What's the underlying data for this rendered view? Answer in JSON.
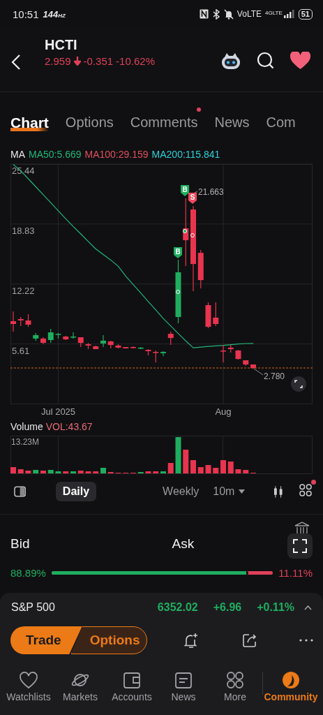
{
  "status_bar": {
    "time": "10:51",
    "refresh_rate": "144",
    "refresh_unit": "HZ",
    "network": "VoLTE",
    "network_type": "4GLTE",
    "battery": "51"
  },
  "header": {
    "symbol": "HCTI",
    "price": "2.959",
    "change": "-0.351",
    "change_percent": "-10.62%"
  },
  "tabs": [
    {
      "label": "Chart",
      "selected": true,
      "badge": false
    },
    {
      "label": "Options",
      "selected": false,
      "badge": false
    },
    {
      "label": "Comments",
      "selected": false,
      "badge": true
    },
    {
      "label": "News",
      "selected": false,
      "badge": false
    },
    {
      "label": "Com",
      "selected": false,
      "badge": false
    }
  ],
  "chart": {
    "indicator": "MA",
    "ma": [
      {
        "label": "MA100:29.159",
        "color": "#e0505f"
      },
      {
        "label": "MA200:115.841",
        "color": "#2fd0d8"
      }
    ],
    "chart_data": {
      "type": "candlestick",
      "grid": true,
      "ylim": [
        -1.04,
        25.44
      ],
      "yticks": [
        5.61,
        12.22,
        18.83,
        25.44
      ],
      "categories": [
        null,
        null,
        null,
        null,
        null,
        null,
        "Jul 2025",
        null,
        null,
        null,
        null,
        null,
        null,
        null,
        null,
        null,
        null,
        null,
        null,
        null,
        null,
        null,
        null,
        null,
        null,
        null,
        null,
        null,
        "Aug",
        null,
        null,
        null,
        null
      ],
      "ohlc": [
        [
          8.12,
          9.2,
          6.97,
          7.81
        ],
        [
          8.35,
          8.58,
          7.58,
          8.2
        ],
        [
          8.2,
          8.89,
          7.5,
          7.74
        ],
        [
          6.2,
          6.81,
          5.97,
          6.58
        ],
        [
          6.2,
          6.35,
          5.58,
          5.73
        ],
        [
          6.04,
          7.27,
          5.73,
          6.89
        ],
        [
          6.66,
          6.81,
          6.2,
          6.73
        ],
        [
          6.43,
          6.5,
          6.04,
          6.12
        ],
        [
          6.35,
          6.89,
          6.2,
          6.43
        ],
        [
          6.35,
          6.35,
          5.27,
          5.73
        ],
        [
          5.58,
          5.73,
          5.04,
          5.43
        ],
        [
          5.35,
          5.43,
          5.04,
          5.04
        ],
        [
          5.66,
          6.58,
          5.27,
          5.97
        ],
        [
          5.89,
          5.97,
          5.12,
          5.5
        ],
        [
          5.43,
          5.58,
          5.12,
          5.2
        ],
        [
          5.27,
          5.27,
          5.12,
          5.12
        ],
        [
          5.27,
          5.35,
          5.12,
          5.2
        ],
        [
          5.12,
          5.27,
          5.04,
          5.2
        ],
        [
          4.96,
          5.04,
          4.35,
          4.81
        ],
        [
          4.73,
          4.89,
          3.58,
          4.66
        ],
        [
          4.58,
          4.81,
          4.27,
          4.73
        ],
        [
          6.73,
          6.97,
          5.5,
          6.27
        ],
        [
          8.58,
          14.89,
          7.89,
          13.51
        ],
        [
          18.36,
          21.66,
          14.2,
          17.05
        ],
        [
          20.44,
          20.82,
          11.43,
          14.43
        ],
        [
          15.66,
          15.97,
          11.74,
          12.66
        ],
        [
          9.89,
          10.2,
          7.35,
          7.5
        ],
        [
          8.51,
          10.2,
          7.58,
          7.81
        ],
        [
          4.89,
          5.5,
          3.58,
          4.81
        ],
        [
          5.2,
          5.5,
          4.66,
          5.04
        ],
        [
          4.89,
          4.96,
          3.89,
          3.96
        ],
        [
          3.81,
          3.81,
          3.19,
          3.35
        ],
        [
          3.35,
          3.35,
          2.89,
          2.96
        ]
      ],
      "series": [
        {
          "name": "MA50:5.669",
          "type": "line",
          "color": "#22b57a",
          "values": [
            25.4,
            24.7,
            23.82,
            22.94,
            22.06,
            21.18,
            20.29,
            19.41,
            18.56,
            17.74,
            16.91,
            16.09,
            15.47,
            14.86,
            14.18,
            13.08,
            12.15,
            11.22,
            10.29,
            9.36,
            8.42,
            7.59,
            6.76,
            5.94,
            5.19,
            5.26,
            5.33,
            5.4,
            5.46,
            5.53,
            5.6,
            5.66,
            5.67
          ]
        }
      ],
      "ref_lines": [
        {
          "axis": "y",
          "value": 2.959,
          "color": "#d0651f"
        }
      ]
    },
    "high_label": "21.663",
    "last_label": "2.780",
    "markers": [
      {
        "text": "B",
        "kind": "buy"
      },
      {
        "text": "S",
        "kind": "sell"
      },
      {
        "text": "B",
        "kind": "buy"
      }
    ]
  },
  "volume": {
    "title": "Volume",
    "reading": "VOL:43.67",
    "max_label": "13.23M"
  },
  "periods": [
    {
      "label": "Daily",
      "selected": true
    },
    {
      "label": "Weekly",
      "selected": false
    },
    {
      "label": "10m",
      "selected": false
    }
  ],
  "order_book": {
    "bid_label": "Bid",
    "ask_label": "Ask",
    "bid_percent": "88.89%",
    "ask_percent": "11.11%",
    "level": 0.8889
  },
  "index_bar": {
    "name": "S&P 500",
    "value": "6352.02",
    "change": "+6.96",
    "change_percent": "+0.11%"
  },
  "actions": {
    "trade": "Trade",
    "options": "Options"
  },
  "nav": [
    {
      "label": "Watchlists",
      "kind": "heart",
      "selected": false
    },
    {
      "label": "Markets",
      "kind": "planet",
      "selected": false
    },
    {
      "label": "Accounts",
      "kind": "wallet",
      "selected": false
    },
    {
      "label": "News",
      "kind": "news",
      "selected": false
    },
    {
      "label": "More",
      "kind": "grid",
      "selected": false
    },
    {
      "label": "Community",
      "kind": "community",
      "selected": true
    }
  ]
}
